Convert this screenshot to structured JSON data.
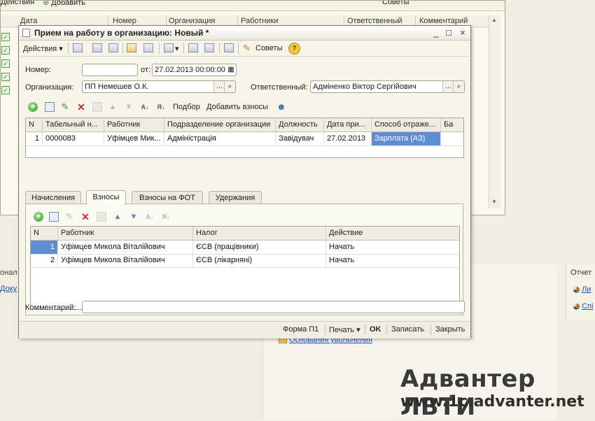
{
  "background": {
    "toolbar_partial": "Действия",
    "toolbar_add": "Добавить",
    "toolbar_tips": "Советы",
    "columns": [
      "Дата",
      "Номер",
      "Организация",
      "Работники",
      "Ответственный",
      "Комментарий"
    ],
    "left_label": "онал",
    "left_link": "Доку",
    "right_title": "Отчет",
    "right_links": [
      "Ли",
      "Спі"
    ],
    "center_link": "Основания увольнения"
  },
  "watermark": {
    "brand": "Адвантер ЛВТИ",
    "url": "www.1c.advanter.net"
  },
  "dialog": {
    "title": "Прием на работу в организацию: Новый *",
    "window_buttons": [
      "_",
      "□",
      "×"
    ],
    "toolbar": {
      "actions": "Действия",
      "tips": "Советы"
    },
    "number_label": "Номер:",
    "number_value": "",
    "date_label": "от:",
    "date_value": "27.02.2013 00:00:00",
    "org_label": "Организация:",
    "org_value": "ПП Немешев О.К.",
    "responsible_label": "Ответственный:",
    "responsible_value": "Адміненко Віктор Сергійович",
    "field_buttons": [
      "...",
      "Q"
    ],
    "employee_toolbar": {
      "select": "Подбор",
      "add_contrib": "Добавить взносы"
    },
    "employees_table": {
      "columns": [
        "N",
        "Табельный н...",
        "Работник",
        "Подразделение организации",
        "Должность",
        "Дата при...",
        "Способ отраже...",
        "Ба"
      ],
      "rows": [
        [
          "1",
          "0000083",
          "Уфімцев Мик...",
          "Адміністрація",
          "Завідувач",
          "27.02.2013",
          "Зарплата (АЗ)",
          ""
        ]
      ]
    },
    "tabs": [
      "Начисления",
      "Взносы",
      "Взносы на ФОТ",
      "Удержания"
    ],
    "active_tab": "Взносы",
    "contrib_table": {
      "columns": [
        "N",
        "Работник",
        "Налог",
        "Действие"
      ],
      "rows": [
        [
          "1",
          "Уфімцев Микола Віталійович",
          "ЄСВ (працівники)",
          "Начать"
        ],
        [
          "2",
          "Уфімцев Микола Віталійович",
          "ЄСВ (лікарняні)",
          "Начать"
        ]
      ]
    },
    "comment_label": "Комментарий:",
    "comment_value": "",
    "bottom": {
      "form": "Форма П1",
      "print": "Печать",
      "ok": "OK",
      "save": "Записать",
      "close": "Закрыть"
    }
  }
}
